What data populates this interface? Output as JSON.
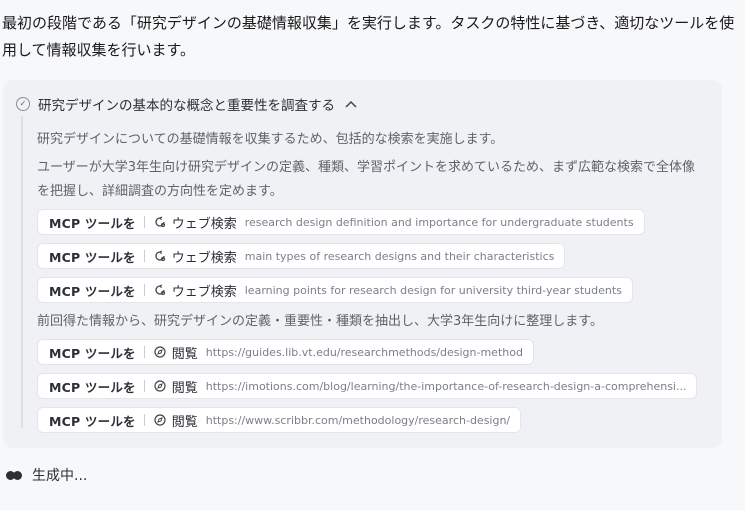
{
  "intro_text": "最初の段階である「研究デザインの基礎情報収集」を実行します。タスクの特性に基づき、適切なツールを使用して情報収集を行います。",
  "task": {
    "title": "研究デザインの基本的な概念と重要性を調査する",
    "collapse_icon": "chevron-up-icon",
    "status_icon": "check-circle-icon"
  },
  "thoughts": [
    "研究デザインについての基礎情報を収集するため、包括的な検索を実施します。",
    "ユーザーが大学3年生向け研究デザインの定義、種類、学習ポイントを求めているため、まず広範な検索で全体像を把握し、詳細調査の方向性を定めます。",
    "前回得た情報から、研究デザインの定義・重要性・種類を抽出し、大学3年生向けに整理します。"
  ],
  "search_calls": [
    {
      "source": "MCP ツールを",
      "action": "ウェブ検索",
      "icon": "search-spinner-icon",
      "arg": "research design definition and importance for undergraduate students"
    },
    {
      "source": "MCP ツールを",
      "action": "ウェブ検索",
      "icon": "search-spinner-icon",
      "arg": "main types of research designs and their characteristics"
    },
    {
      "source": "MCP ツールを",
      "action": "ウェブ検索",
      "icon": "search-spinner-icon",
      "arg": "learning points for research design for university third-year students"
    }
  ],
  "browse_calls": [
    {
      "source": "MCP ツールを",
      "action": "閲覧",
      "icon": "compass-icon",
      "arg": "https://guides.lib.vt.edu/researchmethods/design-method"
    },
    {
      "source": "MCP ツールを",
      "action": "閲覧",
      "icon": "compass-icon",
      "arg": "https://imotions.com/blog/learning/the-importance-of-research-design-a-comprehensi..."
    },
    {
      "source": "MCP ツールを",
      "action": "閲覧",
      "icon": "compass-icon",
      "arg": "https://www.scribbr.com/methodology/research-design/"
    }
  ],
  "status": {
    "label": "生成中..."
  }
}
